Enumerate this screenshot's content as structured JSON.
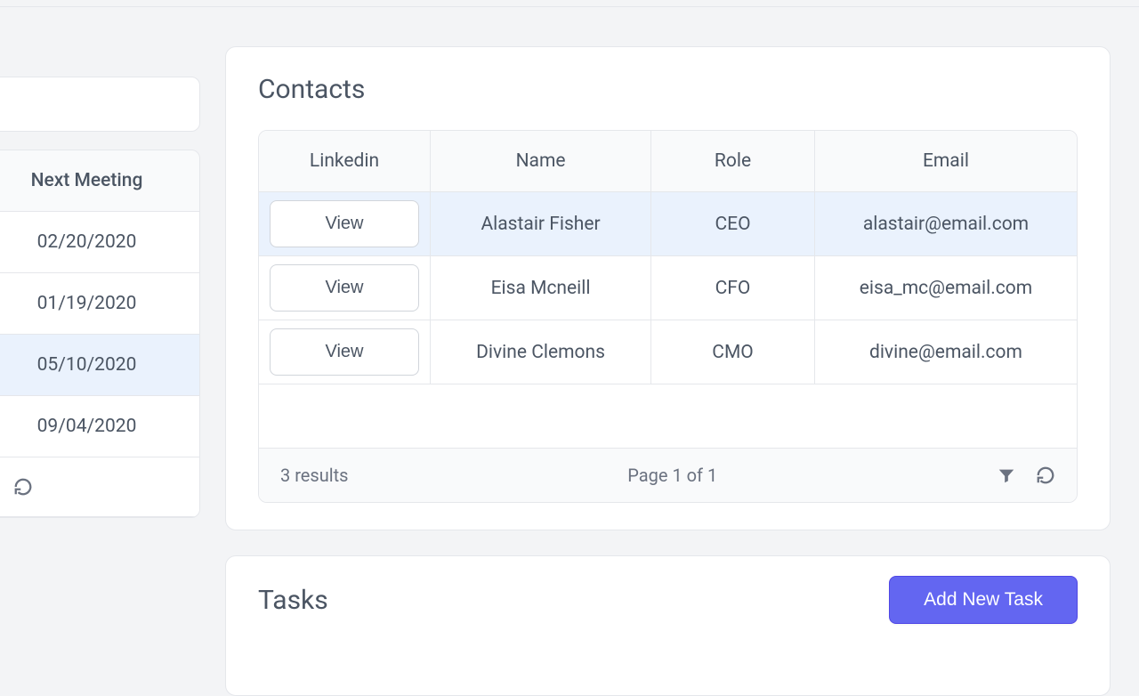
{
  "meetings": {
    "header": "Next Meeting",
    "rows": [
      {
        "date": "02/20/2020",
        "selected": false
      },
      {
        "date": "01/19/2020",
        "selected": false
      },
      {
        "date": "05/10/2020",
        "selected": true
      },
      {
        "date": "09/04/2020",
        "selected": false
      }
    ]
  },
  "contacts": {
    "title": "Contacts",
    "headers": {
      "linkedin": "Linkedin",
      "name": "Name",
      "role": "Role",
      "email": "Email"
    },
    "view_label": "View",
    "rows": [
      {
        "name": "Alastair Fisher",
        "role": "CEO",
        "email": "alastair@email.com",
        "selected": true
      },
      {
        "name": "Eisa Mcneill",
        "role": "CFO",
        "email": "eisa_mc@email.com",
        "selected": false
      },
      {
        "name": "Divine Clemons",
        "role": "CMO",
        "email": "divine@email.com",
        "selected": false
      }
    ],
    "footer": {
      "results": "3 results",
      "page": "Page 1 of 1"
    }
  },
  "tasks": {
    "title": "Tasks",
    "add_label": "Add New Task"
  }
}
